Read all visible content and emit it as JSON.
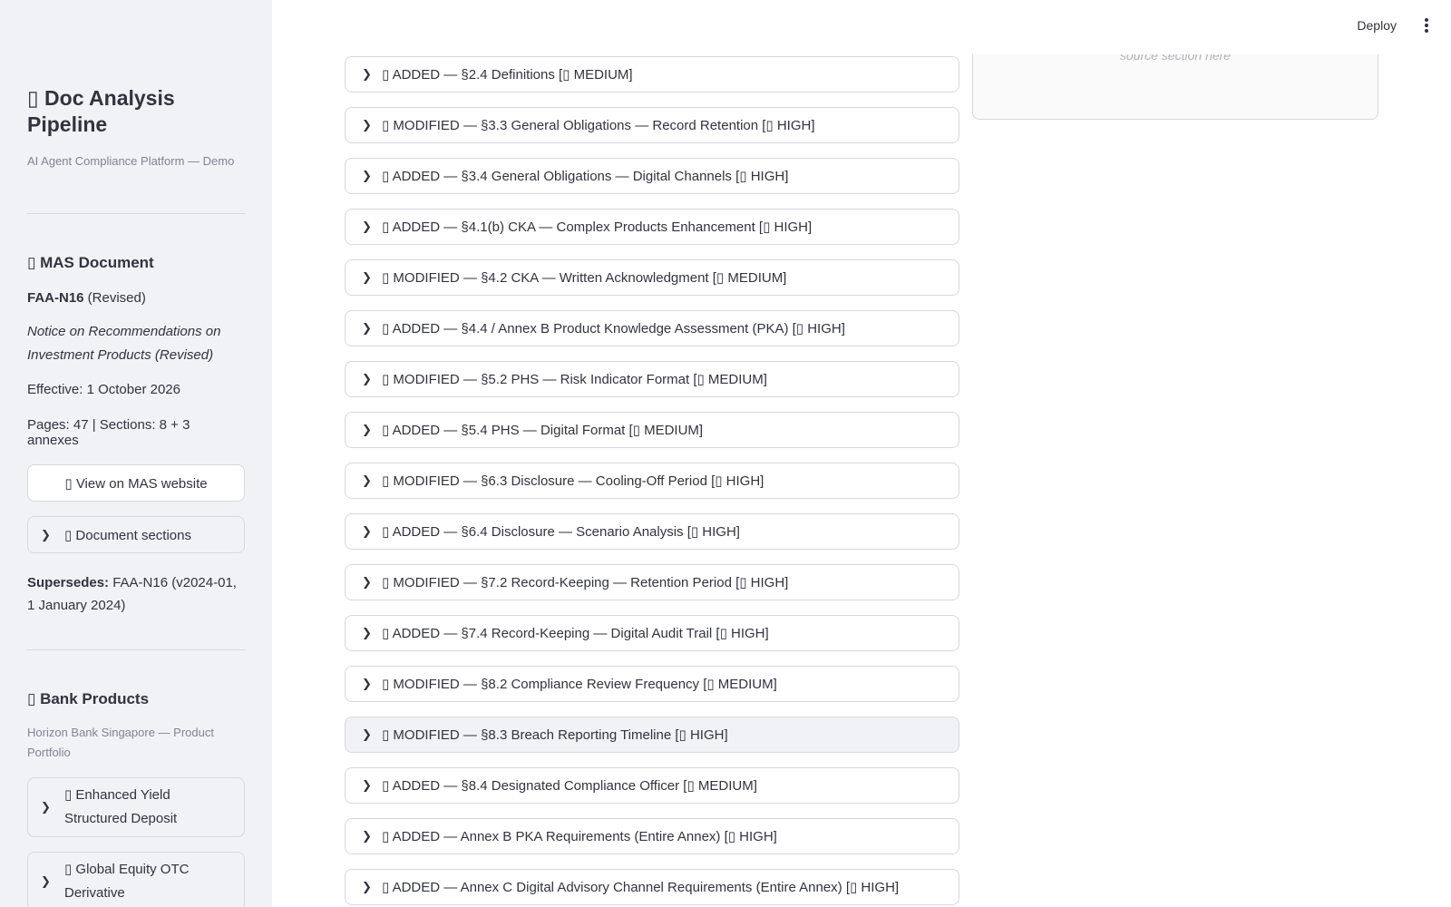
{
  "sidebar": {
    "app_title": "▯ Doc Analysis Pipeline",
    "app_subtitle": "AI Agent Compliance Platform — Demo",
    "mas": {
      "heading": "▯ MAS Document",
      "code": "FAA-N16",
      "code_suffix": " (Revised)",
      "title": "Notice on Recommendations on Investment Products (Revised)",
      "effective": "Effective: 1 October 2026",
      "pages": "Pages: 47 | Sections: 8 + 3 annexes",
      "view_button": "▯ View on MAS website",
      "sections_expander": "▯ Document sections",
      "supersedes_label": "Supersedes:",
      "supersedes_value": " FAA-N16 (v2024-01, 1 January 2024)"
    },
    "bank": {
      "heading": "▯ Bank Products",
      "subtitle": "Horizon Bank Singapore — Product Portfolio",
      "products": [
        {
          "label": "▯ Enhanced Yield Structured Deposit"
        },
        {
          "label": "▯ Global Equity OTC Derivative"
        }
      ]
    }
  },
  "header": {
    "deploy_label": "Deploy",
    "menu_icon": "kebab-icon"
  },
  "right_panel": {
    "placeholder": "source section here"
  },
  "changes": [
    {
      "label": "▯ ADDED — §2.4 Definitions [▯ MEDIUM]"
    },
    {
      "label": "▯ MODIFIED — §3.3 General Obligations — Record Retention [▯ HIGH]"
    },
    {
      "label": "▯ ADDED — §3.4 General Obligations — Digital Channels [▯ HIGH]"
    },
    {
      "label": "▯ ADDED — §4.1(b) CKA — Complex Products Enhancement [▯ HIGH]"
    },
    {
      "label": "▯ MODIFIED — §4.2 CKA — Written Acknowledgment [▯ MEDIUM]"
    },
    {
      "label": "▯ ADDED — §4.4 / Annex B Product Knowledge Assessment (PKA) [▯ HIGH]"
    },
    {
      "label": "▯ MODIFIED — §5.2 PHS — Risk Indicator Format [▯ MEDIUM]"
    },
    {
      "label": "▯ ADDED — §5.4 PHS — Digital Format [▯ MEDIUM]"
    },
    {
      "label": "▯ MODIFIED — §6.3 Disclosure — Cooling-Off Period [▯ HIGH]"
    },
    {
      "label": "▯ ADDED — §6.4 Disclosure — Scenario Analysis [▯ HIGH]"
    },
    {
      "label": "▯ MODIFIED — §7.2 Record-Keeping — Retention Period [▯ HIGH]"
    },
    {
      "label": "▯ ADDED — §7.4 Record-Keeping — Digital Audit Trail [▯ HIGH]"
    },
    {
      "label": "▯ MODIFIED — §8.2 Compliance Review Frequency [▯ MEDIUM]"
    },
    {
      "label": "▯ MODIFIED — §8.3 Breach Reporting Timeline [▯ HIGH]"
    },
    {
      "label": "▯ ADDED — §8.4 Designated Compliance Officer [▯ MEDIUM]"
    },
    {
      "label": "▯ ADDED — Annex B PKA Requirements (Entire Annex) [▯ HIGH]"
    },
    {
      "label": "▯ ADDED — Annex C Digital Advisory Channel Requirements (Entire Annex) [▯ HIGH]"
    }
  ],
  "hovered_change_index": 13
}
